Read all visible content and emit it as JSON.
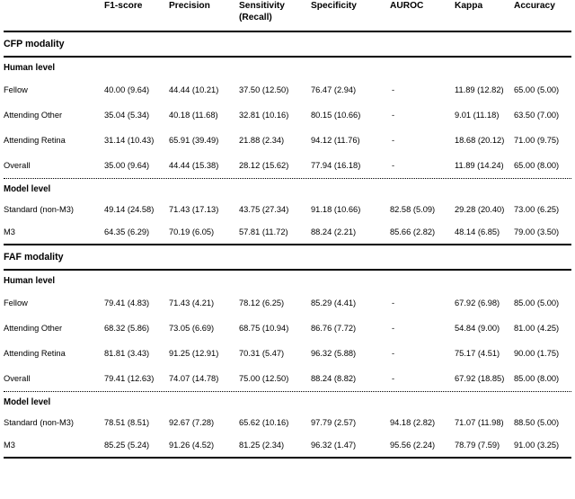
{
  "table": {
    "columns": [
      {
        "key": "label",
        "label": "",
        "label2": ""
      },
      {
        "key": "f1",
        "label": "F1-score",
        "label2": ""
      },
      {
        "key": "prec",
        "label": "Precision",
        "label2": ""
      },
      {
        "key": "sens",
        "label": "Sensitivity",
        "label2": "(Recall)"
      },
      {
        "key": "spec",
        "label": "Specificity",
        "label2": ""
      },
      {
        "key": "auroc",
        "label": "AUROC",
        "label2": ""
      },
      {
        "key": "kappa",
        "label": "Kappa",
        "label2": ""
      },
      {
        "key": "acc",
        "label": "Accuracy",
        "label2": ""
      }
    ],
    "sections": [
      {
        "title": "CFP modality",
        "groups": [
          {
            "title": "Human level",
            "rows": [
              {
                "label": "Fellow",
                "f1": "40.00 (9.64)",
                "prec": "44.44 (10.21)",
                "sens": "37.50 (12.50)",
                "spec": "76.47 (2.94)",
                "auroc": "-",
                "kappa": "11.89 (12.82)",
                "acc": "65.00 (5.00)"
              },
              {
                "label": "Attending Other",
                "f1": "35.04 (5.34)",
                "prec": "40.18 (11.68)",
                "sens": "32.81 (10.16)",
                "spec": "80.15 (10.66)",
                "auroc": "-",
                "kappa": "9.01 (11.18)",
                "acc": "63.50 (7.00)"
              },
              {
                "label": "Attending Retina",
                "f1": "31.14 (10.43)",
                "prec": "65.91 (39.49)",
                "sens": "21.88 (2.34)",
                "spec": "94.12 (11.76)",
                "auroc": "-",
                "kappa": "18.68 (20.12)",
                "acc": "71.00 (9.75)"
              },
              {
                "label": "Overall",
                "f1": "35.00 (9.64)",
                "prec": "44.44 (15.38)",
                "sens": "28.12 (15.62)",
                "spec": "77.94 (16.18)",
                "auroc": "-",
                "kappa": "11.89 (14.24)",
                "acc": "65.00 (8.00)"
              }
            ]
          },
          {
            "title": "Model level",
            "rows": [
              {
                "label": "Standard (non-M3)",
                "f1": "49.14 (24.58)",
                "prec": "71.43 (17.13)",
                "sens": "43.75 (27.34)",
                "spec": "91.18 (10.66)",
                "auroc": "82.58 (5.09)",
                "kappa": "29.28 (20.40)",
                "acc": "73.00 (6.25)"
              },
              {
                "label": "M3",
                "f1": "64.35 (6.29)",
                "prec": "70.19 (6.05)",
                "sens": "57.81 (11.72)",
                "spec": "88.24 (2.21)",
                "auroc": "85.66 (2.82)",
                "kappa": "48.14 (6.85)",
                "acc": "79.00 (3.50)"
              }
            ]
          }
        ]
      },
      {
        "title": "FAF modality",
        "groups": [
          {
            "title": "Human level",
            "rows": [
              {
                "label": "Fellow",
                "f1": "79.41 (4.83)",
                "prec": "71.43 (4.21)",
                "sens": "78.12 (6.25)",
                "spec": "85.29 (4.41)",
                "auroc": "-",
                "kappa": "67.92 (6.98)",
                "acc": "85.00 (5.00)"
              },
              {
                "label": "Attending Other",
                "f1": "68.32 (5.86)",
                "prec": "73.05 (6.69)",
                "sens": "68.75 (10.94)",
                "spec": "86.76 (7.72)",
                "auroc": "-",
                "kappa": "54.84 (9.00)",
                "acc": "81.00 (4.25)"
              },
              {
                "label": "Attending Retina",
                "f1": "81.81 (3.43)",
                "prec": "91.25 (12.91)",
                "sens": "70.31 (5.47)",
                "spec": "96.32 (5.88)",
                "auroc": "-",
                "kappa": "75.17 (4.51)",
                "acc": "90.00 (1.75)"
              },
              {
                "label": "Overall",
                "f1": "79.41 (12.63)",
                "prec": "74.07 (14.78)",
                "sens": "75.00 (12.50)",
                "spec": "88.24 (8.82)",
                "auroc": "-",
                "kappa": "67.92 (18.85)",
                "acc": "85.00 (8.00)"
              }
            ]
          },
          {
            "title": "Model level",
            "rows": [
              {
                "label": "Standard (non-M3)",
                "f1": "78.51 (8.51)",
                "prec": "92.67 (7.28)",
                "sens": "65.62 (10.16)",
                "spec": "97.79 (2.57)",
                "auroc": "94.18 (2.82)",
                "kappa": "71.07 (11.98)",
                "acc": "88.50 (5.00)"
              },
              {
                "label": "M3",
                "f1": "85.25 (5.24)",
                "prec": "91.26 (4.52)",
                "sens": "81.25 (2.34)",
                "spec": "96.32 (1.47)",
                "auroc": "95.56 (2.24)",
                "kappa": "78.79 (7.59)",
                "acc": "91.00 (3.25)"
              }
            ]
          }
        ]
      }
    ]
  }
}
